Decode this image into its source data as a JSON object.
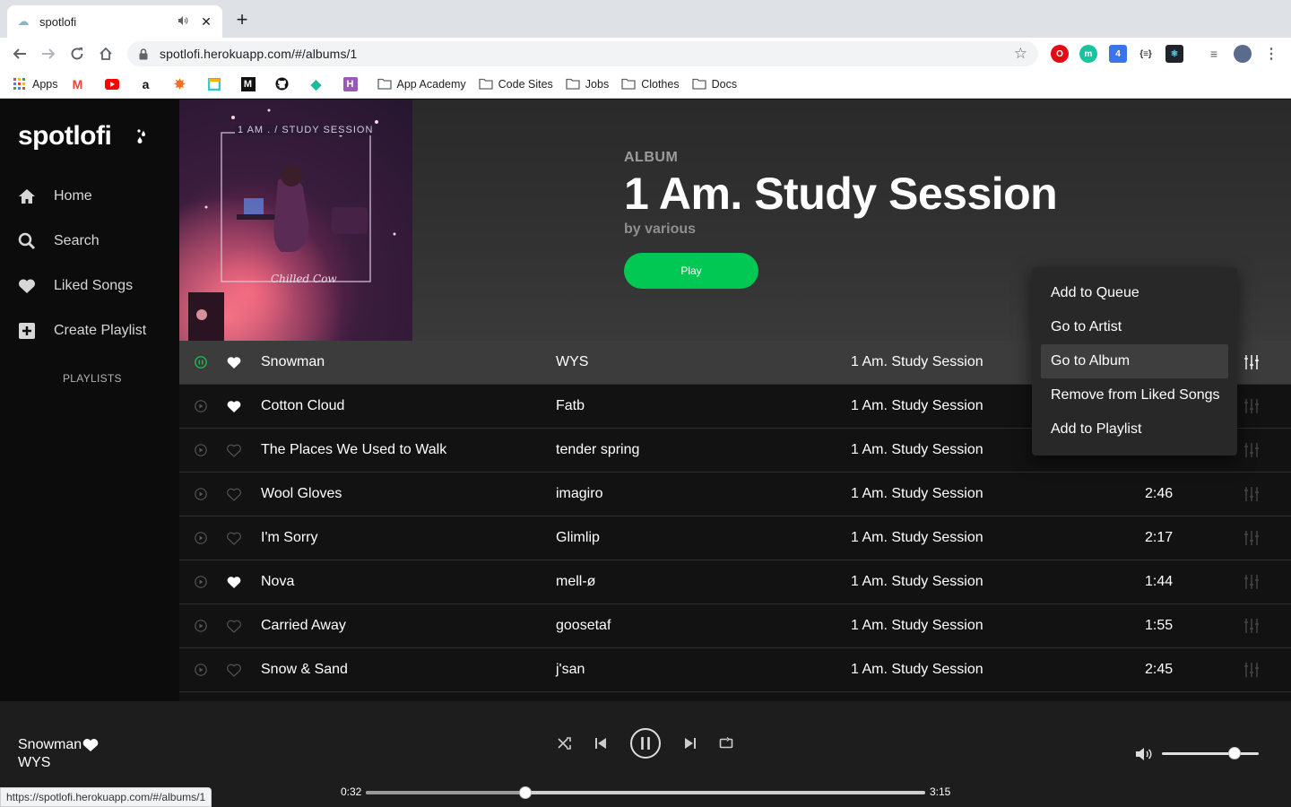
{
  "browser": {
    "tab_title": "spotlofi",
    "url": "spotlofi.herokuapp.com/#/albums/1",
    "bookmarks": {
      "apps": "Apps",
      "folders": [
        "App Academy",
        "Code Sites",
        "Jobs",
        "Clothes",
        "Docs"
      ]
    },
    "status_url": "https://spotlofi.herokuapp.com/#/albums/1"
  },
  "sidebar": {
    "logo": "spotlofi",
    "items": [
      {
        "label": "Home",
        "icon": "home-icon"
      },
      {
        "label": "Search",
        "icon": "search-icon"
      },
      {
        "label": "Liked Songs",
        "icon": "heart-icon"
      },
      {
        "label": "Create Playlist",
        "icon": "plus-square-icon"
      }
    ],
    "playlists_label": "PLAYLISTS"
  },
  "album": {
    "type": "ALBUM",
    "title": "1 Am. Study Session",
    "artist": "by various",
    "play_label": "Play",
    "cover_text": "1 AM . / STUDY SESSION",
    "cover_signature": "Chilled Cow"
  },
  "tracks": [
    {
      "title": "Snowman",
      "artist": "WYS",
      "album": "1 Am. Study Session",
      "duration": "",
      "liked": true,
      "playing": true
    },
    {
      "title": "Cotton Cloud",
      "artist": "Fatb",
      "album": "1 Am. Study Session",
      "duration": "",
      "liked": true,
      "playing": false
    },
    {
      "title": "The Places We Used to Walk",
      "artist": "tender spring",
      "album": "1 Am. Study Session",
      "duration": "",
      "liked": false,
      "playing": false
    },
    {
      "title": "Wool Gloves",
      "artist": "imagiro",
      "album": "1 Am. Study Session",
      "duration": "2:46",
      "liked": false,
      "playing": false
    },
    {
      "title": "I'm Sorry",
      "artist": "Glimlip",
      "album": "1 Am. Study Session",
      "duration": "2:17",
      "liked": false,
      "playing": false
    },
    {
      "title": "Nova",
      "artist": "mell-ø",
      "album": "1 Am. Study Session",
      "duration": "1:44",
      "liked": true,
      "playing": false
    },
    {
      "title": "Carried Away",
      "artist": "goosetaf",
      "album": "1 Am. Study Session",
      "duration": "1:55",
      "liked": false,
      "playing": false
    },
    {
      "title": "Snow & Sand",
      "artist": "j'san",
      "album": "1 Am. Study Session",
      "duration": "2:45",
      "liked": false,
      "playing": false
    }
  ],
  "context_menu": {
    "items": [
      "Add to Queue",
      "Go to Artist",
      "Go to Album",
      "Remove from Liked Songs",
      "Add to Playlist"
    ],
    "highlighted": "Go to Album"
  },
  "player": {
    "title": "Snowman",
    "artist": "WYS",
    "elapsed": "0:32",
    "total": "3:15",
    "progress_fraction": 0.286,
    "volume_fraction": 0.75
  },
  "colors": {
    "accent_green": "#00c853",
    "sidebar_bg": "#0c0c0c",
    "main_bg": "#121212",
    "player_bg": "#1d1d1d",
    "menu_bg": "#282828"
  }
}
